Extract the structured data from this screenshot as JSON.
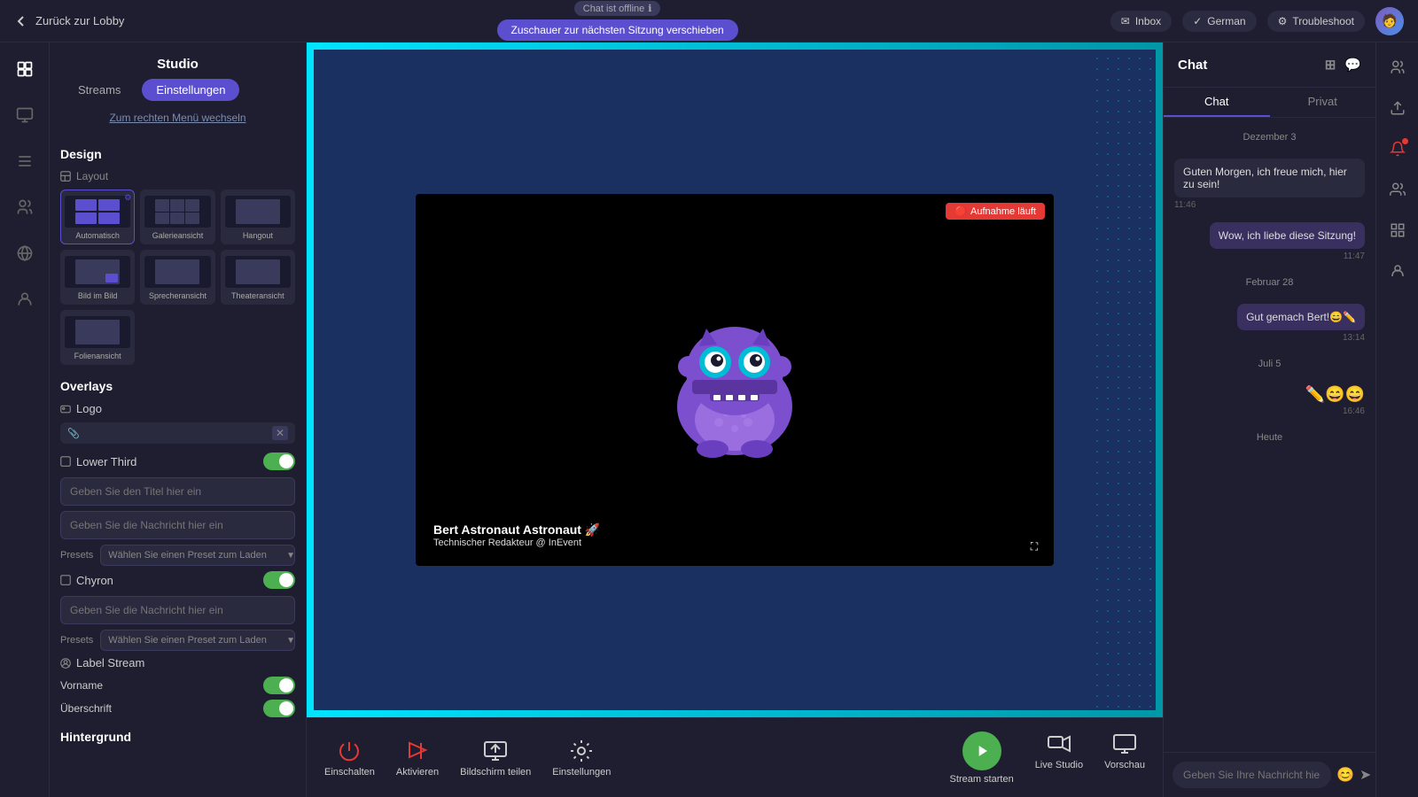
{
  "topbar": {
    "back_label": "Zurück zur Lobby",
    "offline_label": "Chat ist offline",
    "move_label": "Zuschauer zur nächsten Sitzung verschieben",
    "inbox_label": "Inbox",
    "language_label": "German",
    "troubleshoot_label": "Troubleshoot"
  },
  "studio": {
    "title": "Studio",
    "tab_streams": "Streams",
    "tab_settings": "Einstellungen",
    "submenu": "Zum rechten Menü wechseln",
    "design_label": "Design",
    "layout_label": "Layout",
    "layouts": [
      {
        "id": "auto",
        "label": "Automatisch",
        "active": true
      },
      {
        "id": "gallery",
        "label": "Galerieansicht",
        "active": false
      },
      {
        "id": "hangout",
        "label": "Hangout",
        "active": false
      },
      {
        "id": "pip",
        "label": "Bild im Bild",
        "active": false
      },
      {
        "id": "speaker",
        "label": "Sprecheransicht",
        "active": false
      },
      {
        "id": "theater",
        "label": "Theateransicht",
        "active": false
      },
      {
        "id": "folien",
        "label": "Folienansicht",
        "active": false
      }
    ],
    "overlays_label": "Overlays",
    "logo_label": "Logo",
    "logo_placeholder": "",
    "lower_third_label": "Lower Third",
    "lower_third_toggle": "on",
    "lower_third_title_placeholder": "Geben Sie den Titel hier ein",
    "lower_third_msg_placeholder": "Geben Sie die Nachricht hier ein",
    "presets_label": "Presets",
    "presets_placeholder": "Wählen Sie einen Preset zum Laden",
    "chyron_label": "Chyron",
    "chyron_toggle": "on",
    "chyron_placeholder": "Geben Sie die Nachricht hier ein",
    "chyron_presets_label": "Presets",
    "chyron_presets_placeholder": "Wählen Sie einen Preset zum Laden",
    "label_stream_label": "Label Stream",
    "vorname_label": "Vorname",
    "vorname_toggle": "on",
    "ueberschrift_label": "Überschrift",
    "ueberschrift_toggle": "on",
    "hintergrund_label": "Hintergrund"
  },
  "video": {
    "recording_label": "Aufnahme läuft",
    "presenter_name": "Bert Astronaut Astronaut 🚀",
    "presenter_title": "Technischer Redakteur @ InEvent"
  },
  "toolbar": {
    "einschalten_label": "Einschalten",
    "aktivieren_label": "Aktivieren",
    "bildschirm_label": "Bildschirm teilen",
    "einstellungen_label": "Einstellungen",
    "stream_starten_label": "Stream starten",
    "live_studio_label": "Live Studio",
    "vorschau_label": "Vorschau"
  },
  "chat": {
    "title": "Chat",
    "tab_chat": "Chat",
    "tab_privat": "Privat",
    "date_dezember": "Dezember 3",
    "date_februar": "Februar 28",
    "date_juli": "Juli 5",
    "date_heute": "Heute",
    "messages": [
      {
        "text": "Guten Morgen, ich freue mich, hier zu sein!",
        "time": "11:46",
        "side": "left"
      },
      {
        "text": "Wow, ich liebe diese Sitzung!",
        "time": "11:47",
        "side": "right"
      },
      {
        "text": "Gut gemach Bert!😄✏️",
        "time": "13:14",
        "side": "right"
      },
      {
        "text": "✏️😄😄",
        "time": "16:46",
        "side": "right"
      }
    ],
    "input_placeholder": "Geben Sie Ihre Nachricht hier ein"
  }
}
